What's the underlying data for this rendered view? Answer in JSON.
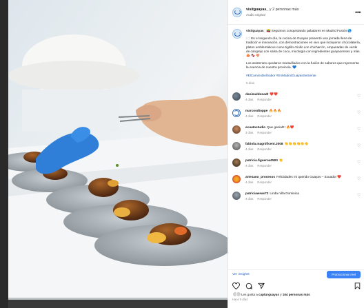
{
  "post": {
    "username": "visitguayas_",
    "collab_text": "y 2 personas más",
    "audio": "Audio original"
  },
  "caption": {
    "username": "visitguayas_",
    "line1": "🇪🇨 Seguimos conquistando paladares en Madrid Fusión 🌎",
    "line2": "🍽️ En el segundo día, la cocina de Guayas presentó una jornada llena de tradición e innovación, con demostraciones en vivo que incluyeron chocolatería, platos emblemáticos como tigrillo criollo con chicharrón, empanadas de verde de cangrejo con salsa de coco, micología con ingredientes guayacenses y más. 🦀 🍫 🍄",
    "line3": "Los asistentes quedaron maravillados con la fusión de sabores que representa la esencia de nuestra provincia. 💙",
    "hashtags": "#ElCaminoDelSabor #EnMadridGuayasSeSiente",
    "time": "5 días"
  },
  "comments": [
    {
      "user": "danimaldonadt",
      "text": "❤️❤️",
      "time": "4 días",
      "reply": "Responder"
    },
    {
      "user": "marcosdtoppe",
      "text": "🔥🔥🔥",
      "time": "4 días",
      "reply": "Responder"
    },
    {
      "user": "ecuatostudio",
      "text": "Que genial!!! 🔥❤️",
      "time": "3 días",
      "reply": "Responder"
    },
    {
      "user": "fabiola.magnificent.2008",
      "text": "👏👏👏👏👏👏",
      "time": "4 días",
      "reply": "Responder"
    },
    {
      "user": "patricia.figueroa0503",
      "text": "👏",
      "time": "4 días",
      "reply": "Responder"
    },
    {
      "user": "artesano_procesos",
      "text": "Felicidades mi querido Guayas – Ecuador ❤️",
      "time": "4 días",
      "reply": "Responder"
    },
    {
      "user": "patriciaweas72",
      "text": "Linda niña Dominica",
      "time": "4 días",
      "reply": "Responder"
    }
  ],
  "insights": {
    "link": "Ver insights",
    "button": "Promocionar reel"
  },
  "likes": {
    "prefix": "Les gusta a",
    "user": "capturguayas",
    "middle": "y",
    "others": "164 personas más"
  },
  "date": "Hace 5 días"
}
